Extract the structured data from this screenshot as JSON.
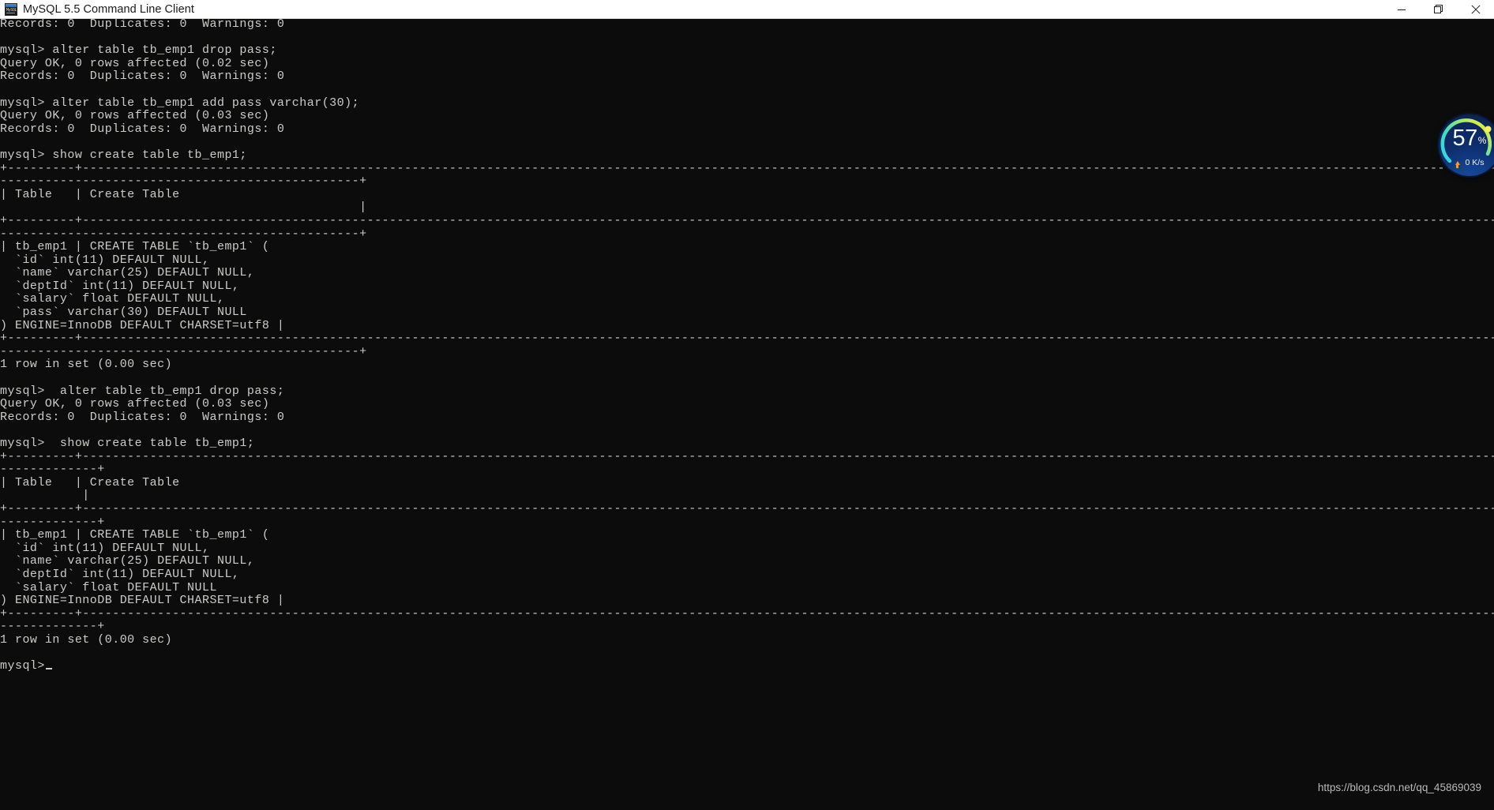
{
  "window": {
    "title": "MySQL 5.5 Command Line Client",
    "icon_name": "mysql-icon",
    "icon_glyph": "MySQL",
    "controls": {
      "minimize_label": "Minimize",
      "restore_label": "Restore",
      "close_label": "Close"
    }
  },
  "terminal": {
    "prompt": "mysql>",
    "lines": [
      "Records: 0  Duplicates: 0  Warnings: 0",
      "",
      "mysql> alter table tb_emp1 drop pass;",
      "Query OK, 0 rows affected (0.02 sec)",
      "Records: 0  Duplicates: 0  Warnings: 0",
      "",
      "mysql> alter table tb_emp1 add pass varchar(30);",
      "Query OK, 0 rows affected (0.03 sec)",
      "Records: 0  Duplicates: 0  Warnings: 0",
      "",
      "mysql> show create table tb_emp1;",
      "+---------+------------------------------------------------------------------------------------------------------------------------------------------------------------------------------------------------------------------------------------",
      "------------------------------------------------+",
      "| Table   | Create Table                                                                                                                                                                                                                         ",
      "                                                |",
      "+---------+------------------------------------------------------------------------------------------------------------------------------------------------------------------------------------------------------------------------------------",
      "------------------------------------------------+",
      "| tb_emp1 | CREATE TABLE `tb_emp1` (",
      "  `id` int(11) DEFAULT NULL,",
      "  `name` varchar(25) DEFAULT NULL,",
      "  `deptId` int(11) DEFAULT NULL,",
      "  `salary` float DEFAULT NULL,",
      "  `pass` varchar(30) DEFAULT NULL",
      ") ENGINE=InnoDB DEFAULT CHARSET=utf8 |",
      "+---------+------------------------------------------------------------------------------------------------------------------------------------------------------------------------------------------------------------------------------------",
      "------------------------------------------------+",
      "1 row in set (0.00 sec)",
      "",
      "mysql>  alter table tb_emp1 drop pass;",
      "Query OK, 0 rows affected (0.03 sec)",
      "Records: 0  Duplicates: 0  Warnings: 0",
      "",
      "mysql>  show create table tb_emp1;",
      "+---------+------------------------------------------------------------------------------------------------------------------------------------------------------------------------------------------------------------------------------------",
      "-------------+",
      "| Table   | Create Table                                                                                                                                                                                                                         ",
      "           |",
      "+---------+------------------------------------------------------------------------------------------------------------------------------------------------------------------------------------------------------------------------------------",
      "-------------+",
      "| tb_emp1 | CREATE TABLE `tb_emp1` (",
      "  `id` int(11) DEFAULT NULL,",
      "  `name` varchar(25) DEFAULT NULL,",
      "  `deptId` int(11) DEFAULT NULL,",
      "  `salary` float DEFAULT NULL",
      ") ENGINE=InnoDB DEFAULT CHARSET=utf8 |",
      "+---------+------------------------------------------------------------------------------------------------------------------------------------------------------------------------------------------------------------------------------------",
      "-------------+",
      "1 row in set (0.00 sec)",
      "",
      "mysql>"
    ]
  },
  "watermark": {
    "text": "https://blog.csdn.net/qq_45869039"
  },
  "speed_widget": {
    "percent": "57",
    "percent_sign": "%",
    "rate": "0 K/s",
    "arrow_name": "upload-arrow-icon",
    "ring_color": "#3fe0c8",
    "ring_color_end": "#f4e03a",
    "accent_color": "#ff9a1e"
  },
  "colors": {
    "terminal_bg": "#0c0c0c",
    "terminal_fg": "#ccccc8",
    "titlebar_bg": "#ffffff",
    "titlebar_fg": "#1a1a1a"
  }
}
